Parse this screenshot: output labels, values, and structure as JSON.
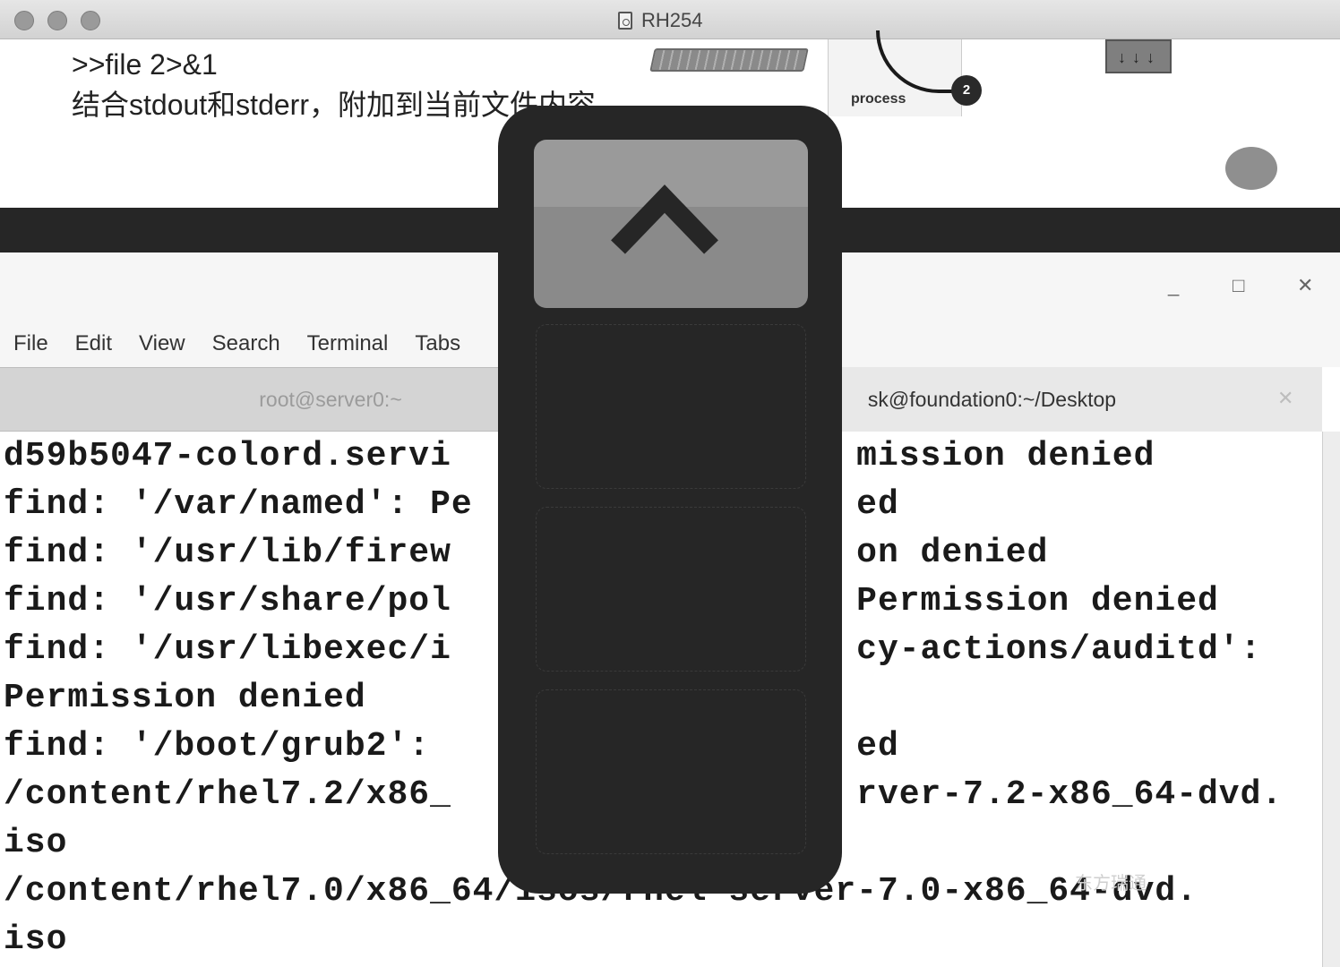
{
  "window": {
    "title": "RH254"
  },
  "slide": {
    "line1": ">>file  2>&1",
    "line2": "结合stdout和stderr，附加到当前文件内容",
    "process_label": "process",
    "process_number": "2"
  },
  "terminal": {
    "menu": [
      "File",
      "Edit",
      "View",
      "Search",
      "Terminal",
      "Tabs"
    ],
    "tabs": [
      "root@server0:~",
      "sk@foundation0:~/Desktop"
    ],
    "window_buttons": {
      "minimize": "_",
      "maximize": "□",
      "close": "✕"
    },
    "tab_close": "✕",
    "lines": [
      "d59b5047-colord.servi                   mission denied",
      "find: '/var/named': Pe                  ed",
      "find: '/usr/lib/firew                   on denied",
      "find: '/usr/share/pol                   Permission denied",
      "find: '/usr/libexec/i                   cy-actions/auditd':",
      "Permission denied",
      "find: '/boot/grub2':                    ed",
      "/content/rhel7.2/x86_                   rver-7.2-x86_64-dvd.",
      "iso",
      "/content/rhel7.0/x86_64/isos/rhel-server-7.0-x86_64-dvd.",
      "iso"
    ],
    "watermark": "东方瑞通"
  },
  "overlay": {
    "up_button_icon": "chevron-up-icon"
  }
}
